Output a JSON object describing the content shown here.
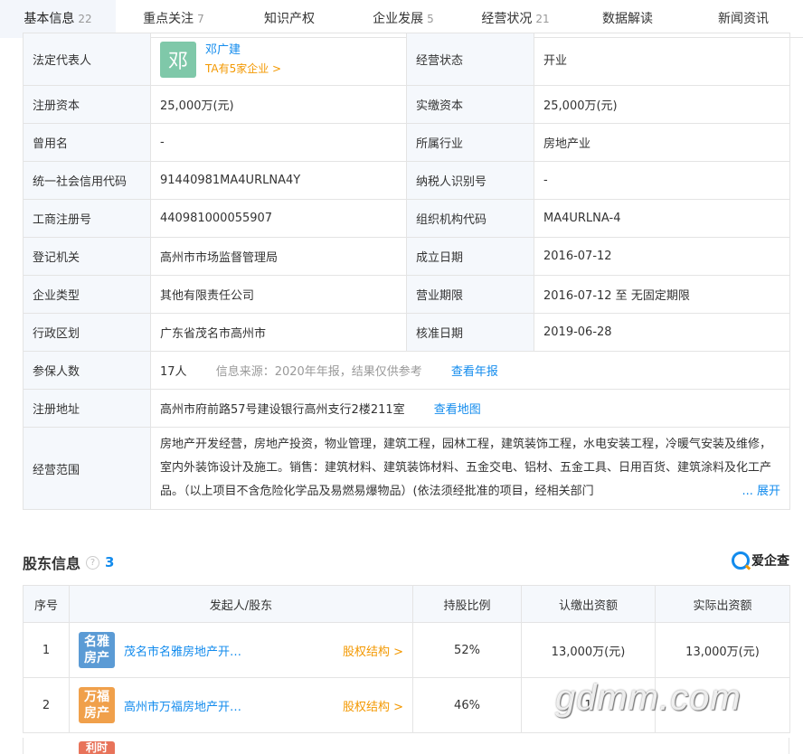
{
  "tabs": [
    {
      "label": "基本信息",
      "count": "22"
    },
    {
      "label": "重点关注",
      "count": "7"
    },
    {
      "label": "知识产权",
      "count": ""
    },
    {
      "label": "企业发展",
      "count": "5"
    },
    {
      "label": "经营状况",
      "count": "21"
    },
    {
      "label": "数据解读",
      "count": ""
    },
    {
      "label": "新闻资讯",
      "count": ""
    }
  ],
  "info": {
    "legal_rep_label": "法定代表人",
    "legal_rep_avatar": "邓",
    "legal_rep_name": "邓广建",
    "legal_rep_sub": "TA有5家企业 >",
    "status_label": "经营状态",
    "status_value": "开业",
    "reg_capital_label": "注册资本",
    "reg_capital_value": "25,000万(元)",
    "paid_capital_label": "实缴资本",
    "paid_capital_value": "25,000万(元)",
    "former_name_label": "曾用名",
    "former_name_value": "-",
    "industry_label": "所属行业",
    "industry_value": "房地产业",
    "credit_code_label": "统一社会信用代码",
    "credit_code_value": "91440981MA4URLNA4Y",
    "taxpayer_label": "纳税人识别号",
    "taxpayer_value": "-",
    "biz_reg_label": "工商注册号",
    "biz_reg_value": "440981000055907",
    "org_code_label": "组织机构代码",
    "org_code_value": "MA4URLNA-4",
    "reg_authority_label": "登记机关",
    "reg_authority_value": "高州市市场监督管理局",
    "est_date_label": "成立日期",
    "est_date_value": "2016-07-12",
    "company_type_label": "企业类型",
    "company_type_value": "其他有限责任公司",
    "biz_term_label": "营业期限",
    "biz_term_value": "2016-07-12 至 无固定期限",
    "region_label": "行政区划",
    "region_value": "广东省茂名市高州市",
    "approval_date_label": "核准日期",
    "approval_date_value": "2019-06-28",
    "insured_label": "参保人数",
    "insured_value": "17人",
    "insured_source": "信息来源：2020年年报，结果仅供参考",
    "insured_link": "查看年报",
    "address_label": "注册地址",
    "address_value": "高州市府前路57号建设银行高州支行2楼211室",
    "address_link": "查看地图",
    "scope_label": "经营范围",
    "scope_value": "房地产开发经营，房地产投资，物业管理，建筑工程，园林工程，建筑装饰工程，水电安装工程，冷暖气安装及维修，室内外装饰设计及施工。销售：建筑材料、建筑装饰材料、五金交电、铝材、五金工具、日用百货、建筑涂料及化工产品。（以上项目不含危险化学品及易燃易爆物品）(依法须经批准的项目，经相关部门",
    "scope_expand": "... 展开"
  },
  "shareholders": {
    "title": "股东信息",
    "help_icon": "?",
    "count": "3",
    "brand": "爱企查",
    "headers": [
      "序号",
      "发起人/股东",
      "持股比例",
      "认缴出资额",
      "实际出资额"
    ],
    "rows": [
      {
        "index": "1",
        "logo": "名雅房产",
        "logo_color": "#5b9bd5",
        "name": "茂名市名雅房地产开…",
        "structure": "股权结构 >",
        "ratio": "52%",
        "subscribed": "13,000万(元)",
        "actual": "13,000万(元)"
      },
      {
        "index": "2",
        "logo": "万福房产",
        "logo_color": "#f0a04b",
        "name": "高州市万福房地产开…",
        "structure": "股权结构 >",
        "ratio": "46%",
        "subscribed": "1",
        "actual": ""
      }
    ],
    "partial_logo": "利时",
    "partial_logo_color": "#e8735a"
  },
  "watermark": "gdmm.com"
}
